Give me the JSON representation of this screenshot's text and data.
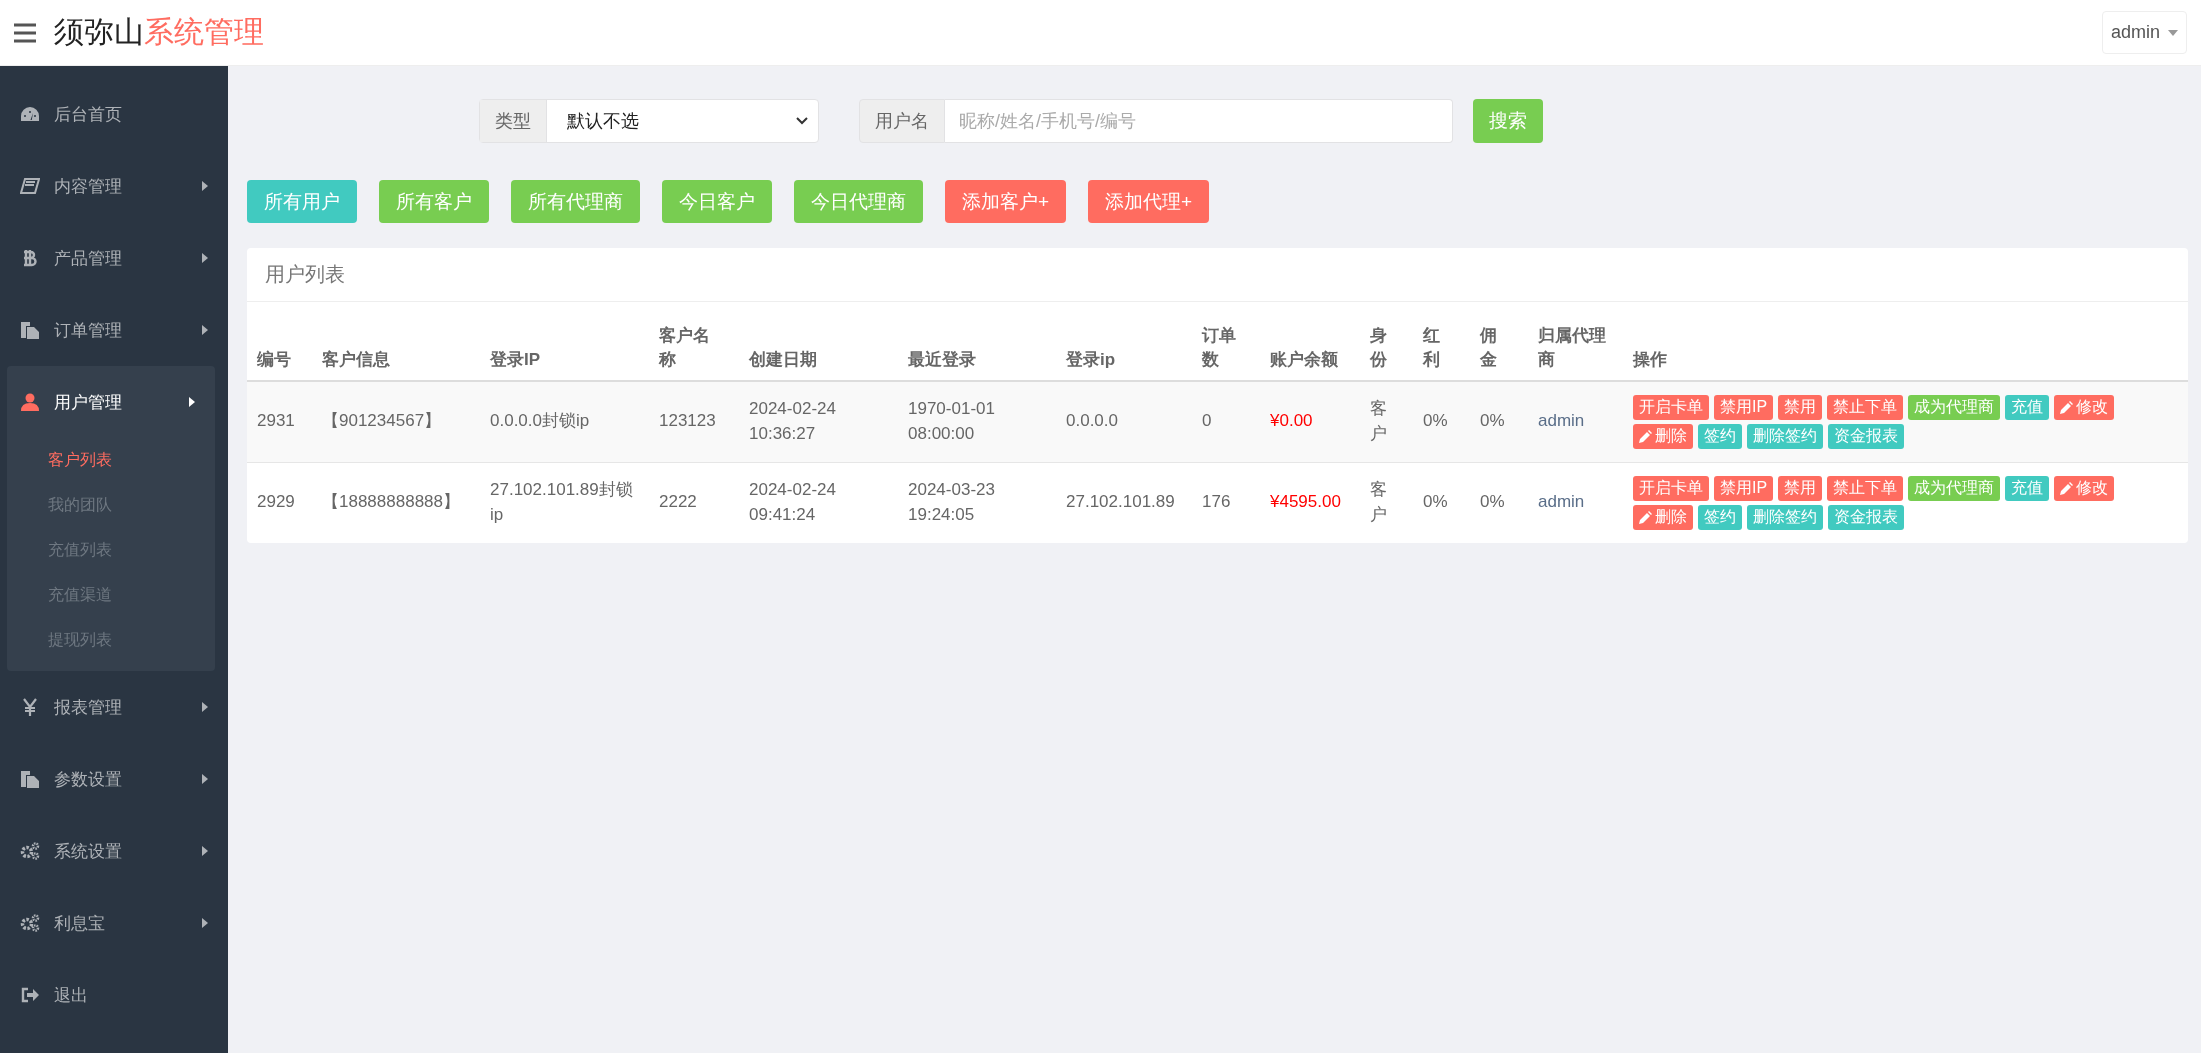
{
  "header": {
    "title_main": "须弥山",
    "title_accent": "系统管理",
    "user": "admin"
  },
  "sidebar": {
    "items": [
      {
        "label": "后台首页"
      },
      {
        "label": "内容管理",
        "expanded": false
      },
      {
        "label": "产品管理",
        "expanded": false
      },
      {
        "label": "订单管理",
        "expanded": false
      },
      {
        "label": "用户管理",
        "expanded": true,
        "children": [
          {
            "label": "客户列表",
            "selected": true
          },
          {
            "label": "我的团队",
            "selected": false
          },
          {
            "label": "充值列表",
            "selected": false
          },
          {
            "label": "充值渠道",
            "selected": false
          },
          {
            "label": "提现列表",
            "selected": false
          }
        ]
      },
      {
        "label": "报表管理",
        "expanded": false
      },
      {
        "label": "参数设置",
        "expanded": false
      },
      {
        "label": "系统设置",
        "expanded": false
      },
      {
        "label": "利息宝",
        "expanded": false
      },
      {
        "label": "退出"
      }
    ]
  },
  "search": {
    "type_label": "类型",
    "type_value": "默认不选",
    "user_label": "用户名",
    "user_placeholder": "昵称/姓名/手机号/编号",
    "button": "搜索"
  },
  "filters": [
    {
      "label": "所有用户",
      "color": "#41cac0"
    },
    {
      "label": "所有客户",
      "color": "#78cd51"
    },
    {
      "label": "所有代理商",
      "color": "#78cd51"
    },
    {
      "label": "今日客户",
      "color": "#78cd51"
    },
    {
      "label": "今日代理商",
      "color": "#78cd51"
    },
    {
      "label": "添加客户+",
      "color": "#ff6c60"
    },
    {
      "label": "添加代理+",
      "color": "#ff6c60"
    }
  ],
  "table": {
    "title": "用户列表",
    "columns": [
      "编号",
      "客户信息",
      "登录IP",
      "客户名称",
      "创建日期",
      "最近登录",
      "登录ip",
      "订单数",
      "账户余额",
      "身份",
      "红利",
      "佣金",
      "归属代理商",
      "操作"
    ],
    "rows": [
      {
        "cells": [
          "2931",
          "【901234567】",
          "0.0.0.0封锁ip",
          "123123",
          "2024-02-24 10:36:27",
          "1970-01-01 08:00:00",
          "0.0.0.0",
          "0",
          "¥0.00",
          "客户",
          "0%",
          "0%",
          "admin"
        ],
        "actions": [
          {
            "label": "开启卡单",
            "color": "#ff6c60",
            "kind": "plain"
          },
          {
            "label": "禁用IP",
            "color": "#ff6c60",
            "kind": "plain"
          },
          {
            "label": "禁用",
            "color": "#ff6c60",
            "kind": "plain"
          },
          {
            "label": "禁止下单",
            "color": "#ff6c60",
            "kind": "plain"
          },
          {
            "label": "成为代理商",
            "color": "#78cd51",
            "kind": "plain"
          },
          {
            "label": "充值",
            "color": "#41cac0",
            "kind": "plain"
          },
          {
            "label": "修改",
            "color": "#ff6c60",
            "kind": "edit"
          },
          {
            "label": "删除",
            "color": "#ff6c60",
            "kind": "edit"
          },
          {
            "label": "签约",
            "color": "#41cac0",
            "kind": "plain"
          },
          {
            "label": "删除签约",
            "color": "#41cac0",
            "kind": "plain"
          },
          {
            "label": "资金报表",
            "color": "#41cac0",
            "kind": "plain"
          }
        ]
      },
      {
        "cells": [
          "2929",
          "【18888888888】",
          "27.102.101.89封锁ip",
          "2222",
          "2024-02-24 09:41:24",
          "2024-03-23 19:24:05",
          "27.102.101.89",
          "176",
          "¥4595.00",
          "客户",
          "0%",
          "0%",
          "admin"
        ],
        "actions": [
          {
            "label": "开启卡单",
            "color": "#ff6c60",
            "kind": "plain"
          },
          {
            "label": "禁用IP",
            "color": "#ff6c60",
            "kind": "plain"
          },
          {
            "label": "禁用",
            "color": "#ff6c60",
            "kind": "plain"
          },
          {
            "label": "禁止下单",
            "color": "#ff6c60",
            "kind": "plain"
          },
          {
            "label": "成为代理商",
            "color": "#78cd51",
            "kind": "plain"
          },
          {
            "label": "充值",
            "color": "#41cac0",
            "kind": "plain"
          },
          {
            "label": "修改",
            "color": "#ff6c60",
            "kind": "edit"
          },
          {
            "label": "删除",
            "color": "#ff6c60",
            "kind": "edit"
          },
          {
            "label": "签约",
            "color": "#41cac0",
            "kind": "plain"
          },
          {
            "label": "删除签约",
            "color": "#41cac0",
            "kind": "plain"
          },
          {
            "label": "资金报表",
            "color": "#41cac0",
            "kind": "plain"
          }
        ]
      }
    ]
  }
}
